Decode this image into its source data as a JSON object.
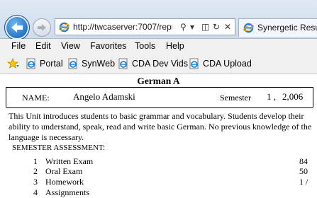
{
  "browser": {
    "address": "http://twcaserver:7007/repr",
    "tab_title": "Synergetic Resu"
  },
  "menu": [
    "File",
    "Edit",
    "View",
    "Favorites",
    "Tools",
    "Help"
  ],
  "favorites": [
    "Portal",
    "SynWeb",
    "CDA Dev Vids",
    "CDA Upload"
  ],
  "report": {
    "title": "German A",
    "name_label": "NAME:",
    "name": "Angelo Adamski",
    "semester_label": "Semester",
    "semester": "1 ,",
    "year": "2,006",
    "description": "This Unit introduces students to basic grammar and vocabulary.  Students develop their ability to understand, speak, read and write basic German.  No previous knowledge of the language is necessary.",
    "assessment_header": "SEMESTER ASSESSMENT:",
    "assessments": [
      {
        "num": "1",
        "label": "Written Exam",
        "value": "84"
      },
      {
        "num": "2",
        "label": "Oral Exam",
        "value": "50"
      },
      {
        "num": "3",
        "label": "Homework",
        "value": "1 /"
      },
      {
        "num": "4",
        "label": "Assignments",
        "value": ""
      }
    ]
  },
  "colors": {
    "back_button": "#1f6fc4",
    "chrome": "#dfe9f5",
    "menu_bg": "#f0f0f0"
  }
}
